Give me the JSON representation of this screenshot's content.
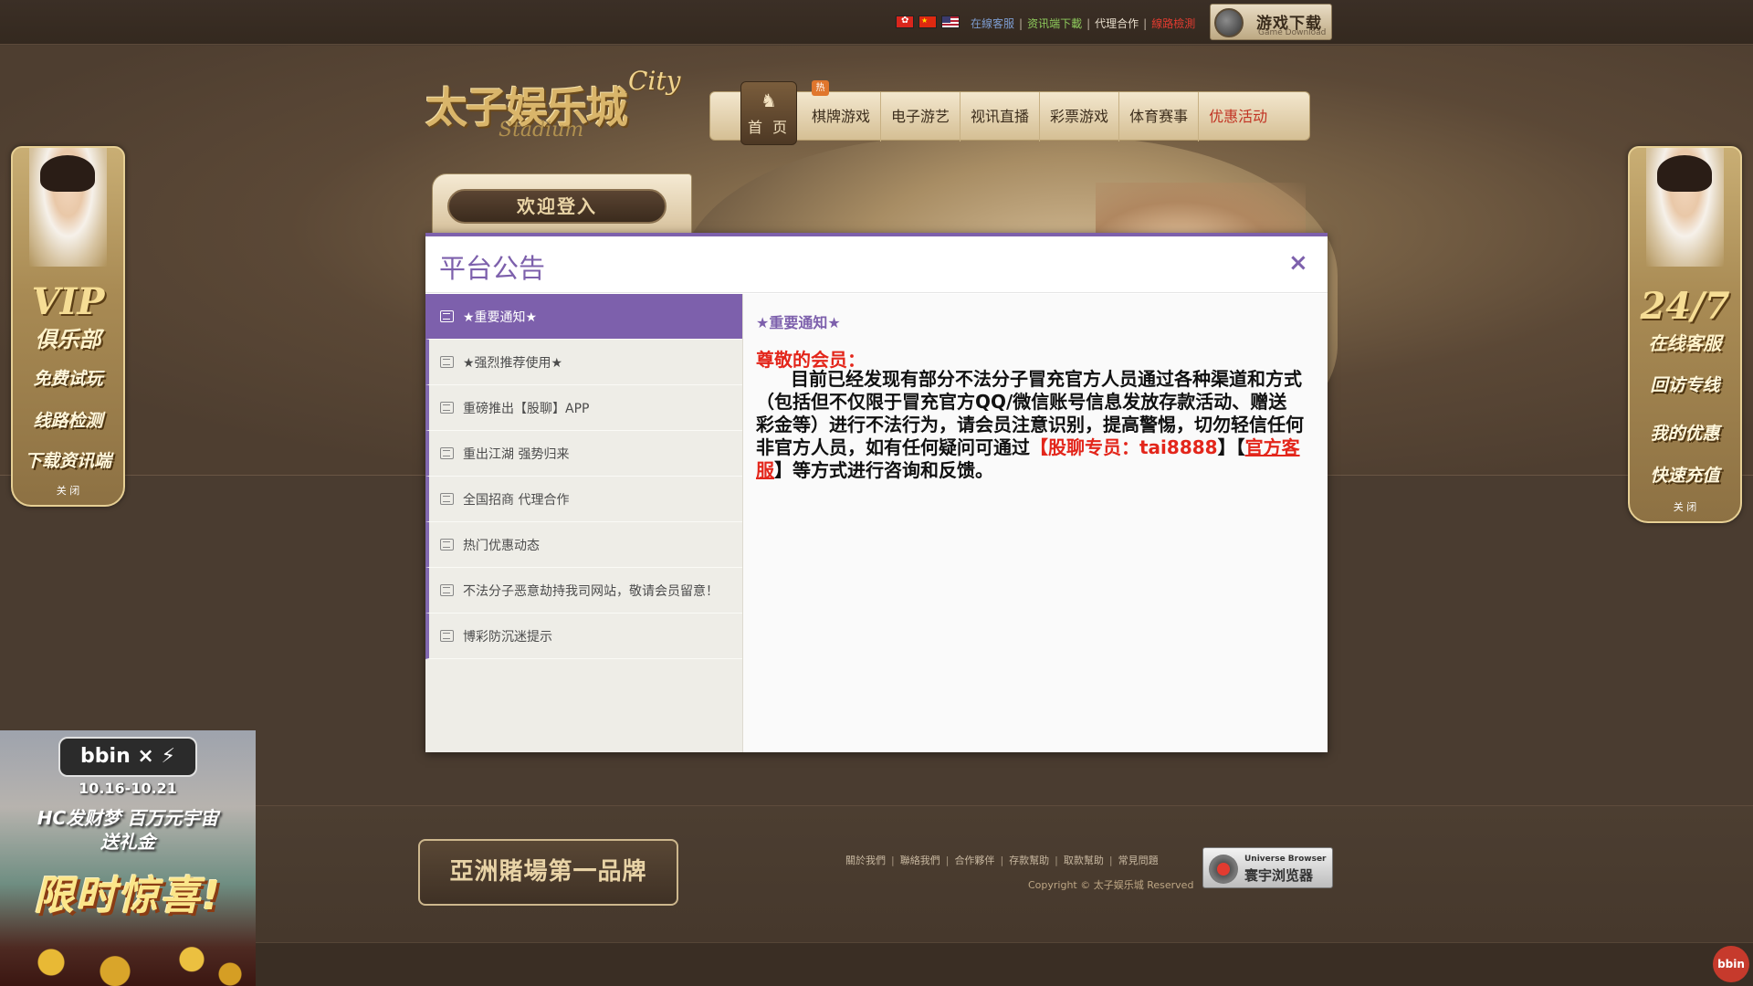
{
  "topbar": {
    "flags": [
      "hk-flag",
      "cn-flag",
      "us-flag"
    ],
    "links": {
      "service": "在線客服",
      "app": "资讯端下載",
      "agent": "代理合作",
      "check": "線路檢測"
    },
    "download": {
      "title": "游戏下载",
      "subtitle": "Game Download"
    }
  },
  "logo": {
    "main": "太子娱乐城",
    "city": "City",
    "sub": "Stadium"
  },
  "nav": {
    "home": "首 页",
    "hot_badge": "热",
    "items": [
      "棋牌游戏",
      "电子游艺",
      "视讯直播",
      "彩票游戏",
      "体育赛事",
      "优惠活动"
    ]
  },
  "login": {
    "label": "欢迎登入"
  },
  "left_panel": {
    "vip": "VIP",
    "club": "俱乐部",
    "items": [
      "免费试玩",
      "线路检测",
      "下载资讯端"
    ],
    "close": "关 闭"
  },
  "right_panel": {
    "badge": "24/7",
    "service": "在线客服",
    "items": [
      "回访专线",
      "我的优惠",
      "快速充值"
    ],
    "close": "关 闭"
  },
  "promo": {
    "logo": "bbin × ⚡",
    "date": "10.16-10.21",
    "line1": "HC发财梦 百万元宇宙",
    "line2": "送礼金",
    "big": "限时惊喜!"
  },
  "modal": {
    "title": "平台公告",
    "close": "×",
    "items": [
      "★重要通知★",
      "★强烈推荐使用★",
      "重磅推出【股聊】APP",
      "重出江湖 强势归来",
      "全国招商 代理合作",
      "热门优惠动态",
      "不法分子恶意劫持我司网站，敬请会员留意！",
      "博彩防沉迷提示"
    ],
    "content": {
      "title": "★重要通知★",
      "greeting": "尊敬的会员：",
      "body_part1": "目前已经发现有部分不法分子冒充官方人员通过各种渠道和方式（包括但不仅限于冒充官方QQ/微信账号信息发放存款活动、赠送彩金等）进行不法行为，请会员注意识别，提高警惕，切勿轻信任何非官方人员，如有任何疑问可通过",
      "highlight": "【股聊专员：tai8888",
      "bracket_open": "】【",
      "service_link": "官方客服",
      "body_part2": "】等方式进行咨询和反馈。"
    }
  },
  "footer": {
    "brand": "亞洲賭場第一品牌",
    "links": [
      "關於我們",
      "聯絡我們",
      "合作夥伴",
      "存款幫助",
      "取款幫助",
      "常見問題"
    ],
    "copyright": "Copyright © 太子娱乐城 Reserved",
    "browser": {
      "en": "Universe Browser",
      "cn": "寰宇浏览器"
    },
    "bbin_badge": "bbin"
  },
  "colors": {
    "accent": "#7d60ac",
    "alert": "#e3261b",
    "gold": "#d9b56a",
    "background": "#4a3c30"
  }
}
